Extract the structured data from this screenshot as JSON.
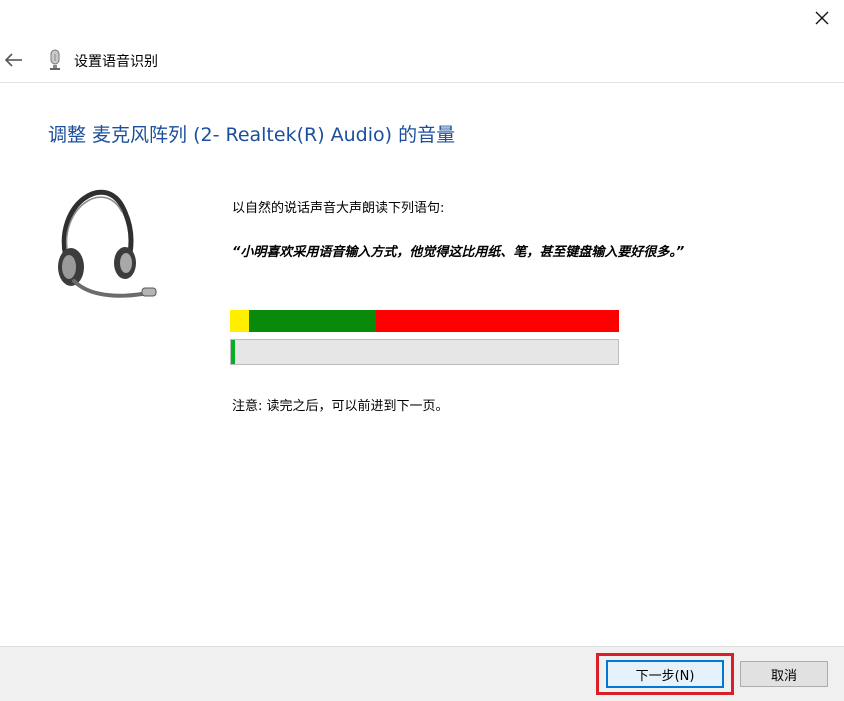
{
  "window": {
    "title": "设置语音识别",
    "close_label": "×"
  },
  "page": {
    "heading": "调整 麦克风阵列 (2- Realtek(R) Audio) 的音量",
    "instruction": "以自然的说话声音大声朗读下列语句:",
    "quote": "“小明喜欢采用语音输入方式，他觉得这比用纸、笔，甚至键盘输入要好很多。”",
    "note": "注意: 读完之后，可以前进到下一页。"
  },
  "level_meter": {
    "colors": [
      "#ffee00",
      "#098a0b",
      "#ff0000"
    ],
    "current_level_fraction": 0.01
  },
  "footer": {
    "next_label": "下一步(N)",
    "cancel_label": "取消"
  },
  "icons": {
    "back": "back-arrow-icon",
    "mic": "microphone-icon",
    "headset": "headset-icon",
    "close": "close-icon"
  },
  "colors": {
    "heading": "#1b4f9c",
    "focus_border": "#0078d7",
    "highlight": "#d9202a"
  }
}
